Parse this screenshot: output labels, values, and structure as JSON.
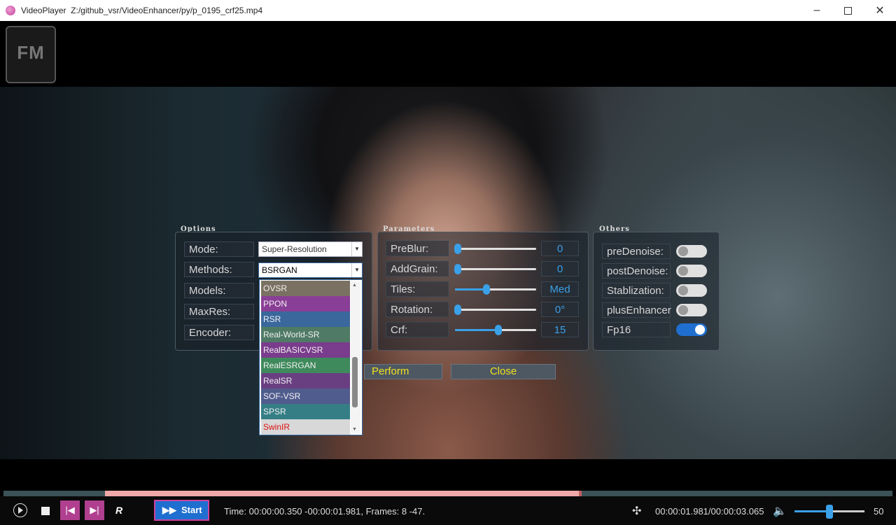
{
  "window": {
    "app_name": "VideoPlayer",
    "file_path": "Z:/github_vsr/VideoEnhancer/py/p_0195_crf25.mp4",
    "controls": [
      "minimize-icon",
      "maximize-icon",
      "close-icon"
    ]
  },
  "overlay": {
    "logo_text": "FM",
    "options": {
      "title": "Options",
      "rows": [
        {
          "label": "Mode:"
        },
        {
          "label": "Methods:"
        },
        {
          "label": "Models:"
        },
        {
          "label": "MaxRes:"
        },
        {
          "label": "Encoder:"
        }
      ],
      "mode_value": "Super-Resolution",
      "methods_value": "BSRGAN",
      "methods_dropdown": [
        {
          "label": "OVSR",
          "bg": "#7b7162",
          "color": "#f0f0f0"
        },
        {
          "label": "PPON",
          "bg": "#8a3f96",
          "color": "#f0f0f0"
        },
        {
          "label": "RSR",
          "bg": "#3a689c",
          "color": "#f0f0f0"
        },
        {
          "label": "Real-World-SR",
          "bg": "#4f7a66",
          "color": "#f0f0f0"
        },
        {
          "label": "RealBASICVSR",
          "bg": "#7a3c8c",
          "color": "#f0f0f0"
        },
        {
          "label": "RealESRGAN",
          "bg": "#3e8a5c",
          "color": "#f0f0f0"
        },
        {
          "label": "RealSR",
          "bg": "#6a3f82",
          "color": "#f0f0f0"
        },
        {
          "label": "SOF-VSR",
          "bg": "#505c8e",
          "color": "#f0f0f0"
        },
        {
          "label": "SPSR",
          "bg": "#357e86",
          "color": "#f0f0f0"
        },
        {
          "label": "SwinIR",
          "bg": "#d8d8d8",
          "color": "#e01010"
        }
      ]
    },
    "parameters": {
      "title": "Parameters",
      "rows": [
        {
          "label": "PreBlur:",
          "value": "0",
          "level": 0.0
        },
        {
          "label": "AddGrain:",
          "value": "0",
          "level": 0.0
        },
        {
          "label": "Tiles:",
          "value": "Med",
          "level": 0.35
        },
        {
          "label": "Rotation:",
          "value": "0°",
          "level": 0.0
        },
        {
          "label": "Crf:",
          "value": "15",
          "level": 0.5
        }
      ]
    },
    "others": {
      "title": "Others",
      "rows": [
        {
          "label": "preDenoise:",
          "on": false
        },
        {
          "label": "postDenoise:",
          "on": false
        },
        {
          "label": "Stablization:",
          "on": false
        },
        {
          "label": "plusEnhancer",
          "on": false
        },
        {
          "label": "Fp16",
          "on": true
        }
      ]
    },
    "perform_label": "Perform",
    "close_label": "Close"
  },
  "player": {
    "progress_played": 0.535,
    "start_label": "Start",
    "r_label": "R",
    "time_info": "Time: 00:00:00.350 -00:00:01.981, Frames: 8 -47.",
    "position_time": "00:00:01.981/00:00:03.065",
    "volume": 50,
    "volume_label": "50"
  },
  "colors": {
    "accent": "#3aa0e8",
    "toggle_off": "#e0e0e0",
    "toggle_on": "#1e6fd0",
    "start_button": "#1e6fd0",
    "magenta_button": "#b0408f",
    "button_text": "#f0e020"
  }
}
